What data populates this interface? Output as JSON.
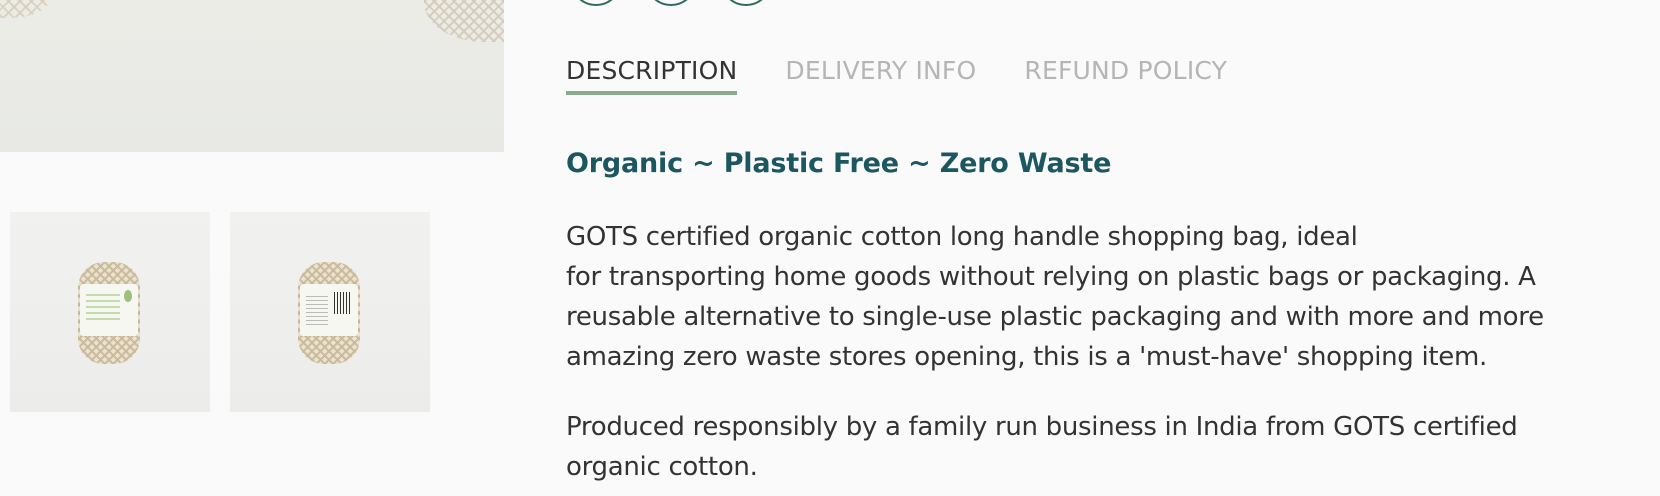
{
  "gallery": {
    "thumbnails": [
      {
        "label": "product-thumbnail-front"
      },
      {
        "label": "product-thumbnail-back"
      }
    ]
  },
  "share": {
    "icons": [
      "share-circle-icon",
      "share-circle-icon",
      "share-circle-icon"
    ]
  },
  "tabs": [
    {
      "label": "DESCRIPTION",
      "active": true
    },
    {
      "label": "DELIVERY INFO",
      "active": false
    },
    {
      "label": "REFUND POLICY",
      "active": false
    }
  ],
  "description": {
    "heading": "Organic ~ Plastic Free ~ Zero Waste",
    "paragraph1_lines": [
      "GOTS certified organic cotton long handle shopping bag, ideal",
      "for transporting home goods without relying on plastic bags or packaging. A",
      "reusable alternative to single-use plastic packaging and with more and more",
      "amazing zero waste stores opening, this is a 'must-have' shopping item."
    ],
    "paragraph2_lines": [
      "Produced responsibly by a family run business in India from GOTS certified",
      "organic cotton."
    ]
  },
  "colors": {
    "heading": "#1c5660",
    "tab_active_underline": "#8aab8c",
    "tab_inactive": "#b5b5b5",
    "body_text": "#333333",
    "share_icon_border": "#2f6a5e"
  }
}
